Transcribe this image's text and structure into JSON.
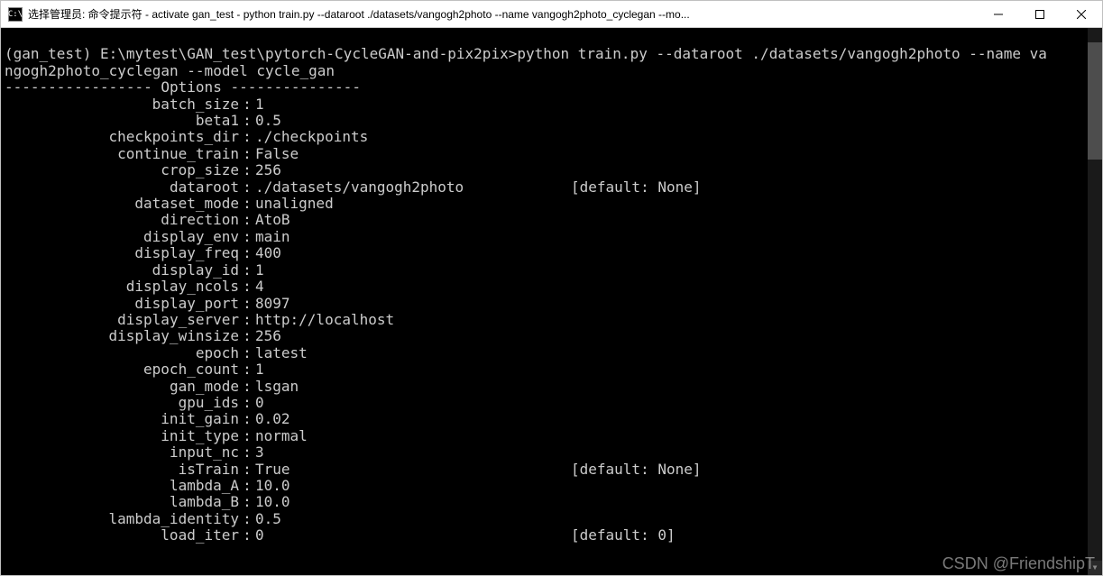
{
  "window": {
    "title": "选择管理员: 命令提示符 - activate  gan_test - python  train.py --dataroot ./datasets/vangogh2photo --name vangogh2photo_cyclegan --mo..."
  },
  "prompt": {
    "line1": "(gan_test) E:\\mytest\\GAN_test\\pytorch-CycleGAN-and-pix2pix>python train.py --dataroot ./datasets/vangogh2photo --name va",
    "line2": "ngogh2photo_cyclegan --model cycle_gan"
  },
  "options_header": "----------------- Options ---------------",
  "options": [
    {
      "key": "batch_size",
      "val": "1",
      "def": ""
    },
    {
      "key": "beta1",
      "val": "0.5",
      "def": ""
    },
    {
      "key": "checkpoints_dir",
      "val": "./checkpoints",
      "def": ""
    },
    {
      "key": "continue_train",
      "val": "False",
      "def": ""
    },
    {
      "key": "crop_size",
      "val": "256",
      "def": ""
    },
    {
      "key": "dataroot",
      "val": "./datasets/vangogh2photo",
      "def": "[default: None]"
    },
    {
      "key": "dataset_mode",
      "val": "unaligned",
      "def": ""
    },
    {
      "key": "direction",
      "val": "AtoB",
      "def": ""
    },
    {
      "key": "display_env",
      "val": "main",
      "def": ""
    },
    {
      "key": "display_freq",
      "val": "400",
      "def": ""
    },
    {
      "key": "display_id",
      "val": "1",
      "def": ""
    },
    {
      "key": "display_ncols",
      "val": "4",
      "def": ""
    },
    {
      "key": "display_port",
      "val": "8097",
      "def": ""
    },
    {
      "key": "display_server",
      "val": "http://localhost",
      "def": ""
    },
    {
      "key": "display_winsize",
      "val": "256",
      "def": ""
    },
    {
      "key": "epoch",
      "val": "latest",
      "def": ""
    },
    {
      "key": "epoch_count",
      "val": "1",
      "def": ""
    },
    {
      "key": "gan_mode",
      "val": "lsgan",
      "def": ""
    },
    {
      "key": "gpu_ids",
      "val": "0",
      "def": ""
    },
    {
      "key": "init_gain",
      "val": "0.02",
      "def": ""
    },
    {
      "key": "init_type",
      "val": "normal",
      "def": ""
    },
    {
      "key": "input_nc",
      "val": "3",
      "def": ""
    },
    {
      "key": "isTrain",
      "val": "True",
      "def": "[default: None]"
    },
    {
      "key": "lambda_A",
      "val": "10.0",
      "def": ""
    },
    {
      "key": "lambda_B",
      "val": "10.0",
      "def": ""
    },
    {
      "key": "lambda_identity",
      "val": "0.5",
      "def": ""
    },
    {
      "key": "load_iter",
      "val": "0",
      "def": "[default: 0]"
    }
  ],
  "watermark": "CSDN @FriendshipT"
}
